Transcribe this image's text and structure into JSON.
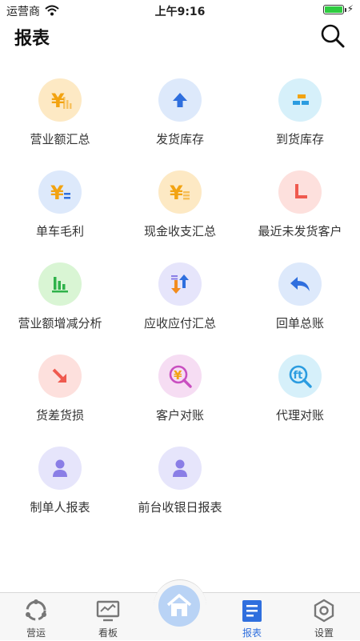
{
  "status": {
    "carrier": "运营商",
    "time": "上午9:16",
    "battery_level": 1.0
  },
  "header": {
    "title": "报表"
  },
  "reports": [
    {
      "label": "营业额汇总",
      "icon": "yen-bars-icon",
      "bg": "#fde9c4",
      "fg": "#f2a311"
    },
    {
      "label": "发货库存",
      "icon": "arrow-up-icon",
      "bg": "#dde9fb",
      "fg": "#2f6fde"
    },
    {
      "label": "到货库存",
      "icon": "bricks-icon",
      "bg": "#d6f0fa",
      "fg": "#2b9ce0"
    },
    {
      "label": "单车毛利",
      "icon": "yen-equals-icon",
      "bg": "#dde9fb",
      "fg": "#f2a311"
    },
    {
      "label": "现金收支汇总",
      "icon": "yen-coins-icon",
      "bg": "#fde9c4",
      "fg": "#f2a311"
    },
    {
      "label": "最近未发货客户",
      "icon": "clock-hand-icon",
      "bg": "#fde0dd",
      "fg": "#ef5a4f"
    },
    {
      "label": "营业额增减分析",
      "icon": "bar-chart-icon",
      "bg": "#d9f5d4",
      "fg": "#2fb24a"
    },
    {
      "label": "应收应付汇总",
      "icon": "up-down-arrows-icon",
      "bg": "#e6e5fb",
      "fg": "#f28c1e"
    },
    {
      "label": "回单总账",
      "icon": "reply-arrow-icon",
      "bg": "#dde9fb",
      "fg": "#2f6fde"
    },
    {
      "label": "货差货损",
      "icon": "arrow-down-right-icon",
      "bg": "#fde0dd",
      "fg": "#ef5a4f"
    },
    {
      "label": "客户对账",
      "icon": "yen-magnifier-icon",
      "bg": "#f6ddf3",
      "fg": "#c94fc0"
    },
    {
      "label": "代理对账",
      "icon": "ft-magnifier-icon",
      "bg": "#d6f0fa",
      "fg": "#2b9ce0"
    },
    {
      "label": "制单人报表",
      "icon": "person-icon",
      "bg": "#e6e5fb",
      "fg": "#8a7ee6"
    },
    {
      "label": "前台收银日报表",
      "icon": "person-icon",
      "bg": "#e6e5fb",
      "fg": "#8a7ee6"
    }
  ],
  "tabbar": {
    "tabs": [
      {
        "label": "营运",
        "icon": "operations-icon",
        "active": false
      },
      {
        "label": "看板",
        "icon": "monitor-icon",
        "active": false
      },
      {
        "label": "报表",
        "icon": "report-icon",
        "active": true
      },
      {
        "label": "设置",
        "icon": "settings-hexagon-icon",
        "active": false
      }
    ],
    "home_icon": "home-icon"
  },
  "colors": {
    "accent": "#2f6fde",
    "home_bg": "#b9d3f5"
  }
}
